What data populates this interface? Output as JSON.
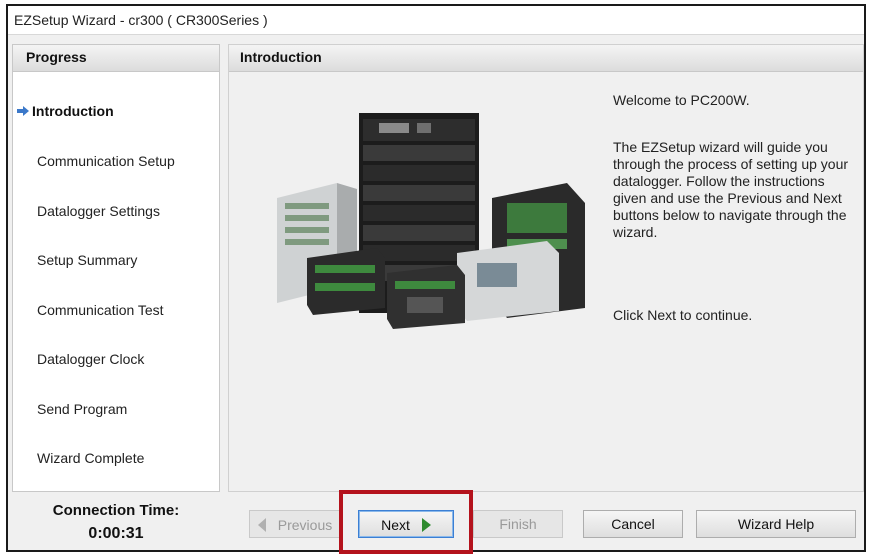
{
  "window": {
    "title": "EZSetup Wizard - cr300 ( CR300Series )"
  },
  "progress": {
    "header": "Progress",
    "steps": [
      {
        "label": "Introduction",
        "active": true
      },
      {
        "label": "Communication Setup"
      },
      {
        "label": "Datalogger Settings"
      },
      {
        "label": "Setup Summary"
      },
      {
        "label": "Communication Test"
      },
      {
        "label": "Datalogger Clock"
      },
      {
        "label": "Send Program"
      },
      {
        "label": "Wizard Complete"
      }
    ]
  },
  "intro": {
    "header": "Introduction",
    "welcome": "Welcome to PC200W.",
    "guide": "The EZSetup wizard will guide you through the process of setting up your datalogger. Follow the instructions given and use the Previous and Next buttons below to navigate through the wizard.",
    "click_next": "Click Next to continue."
  },
  "connection": {
    "label": "Connection Time:",
    "value": "0:00:31"
  },
  "buttons": {
    "previous": "Previous",
    "next": "Next",
    "finish": "Finish",
    "cancel": "Cancel",
    "help": "Wizard Help"
  },
  "colors": {
    "highlight": "#b4121c",
    "next_arrow": "#2e8b2e",
    "active_arrow": "#3b78c9"
  }
}
